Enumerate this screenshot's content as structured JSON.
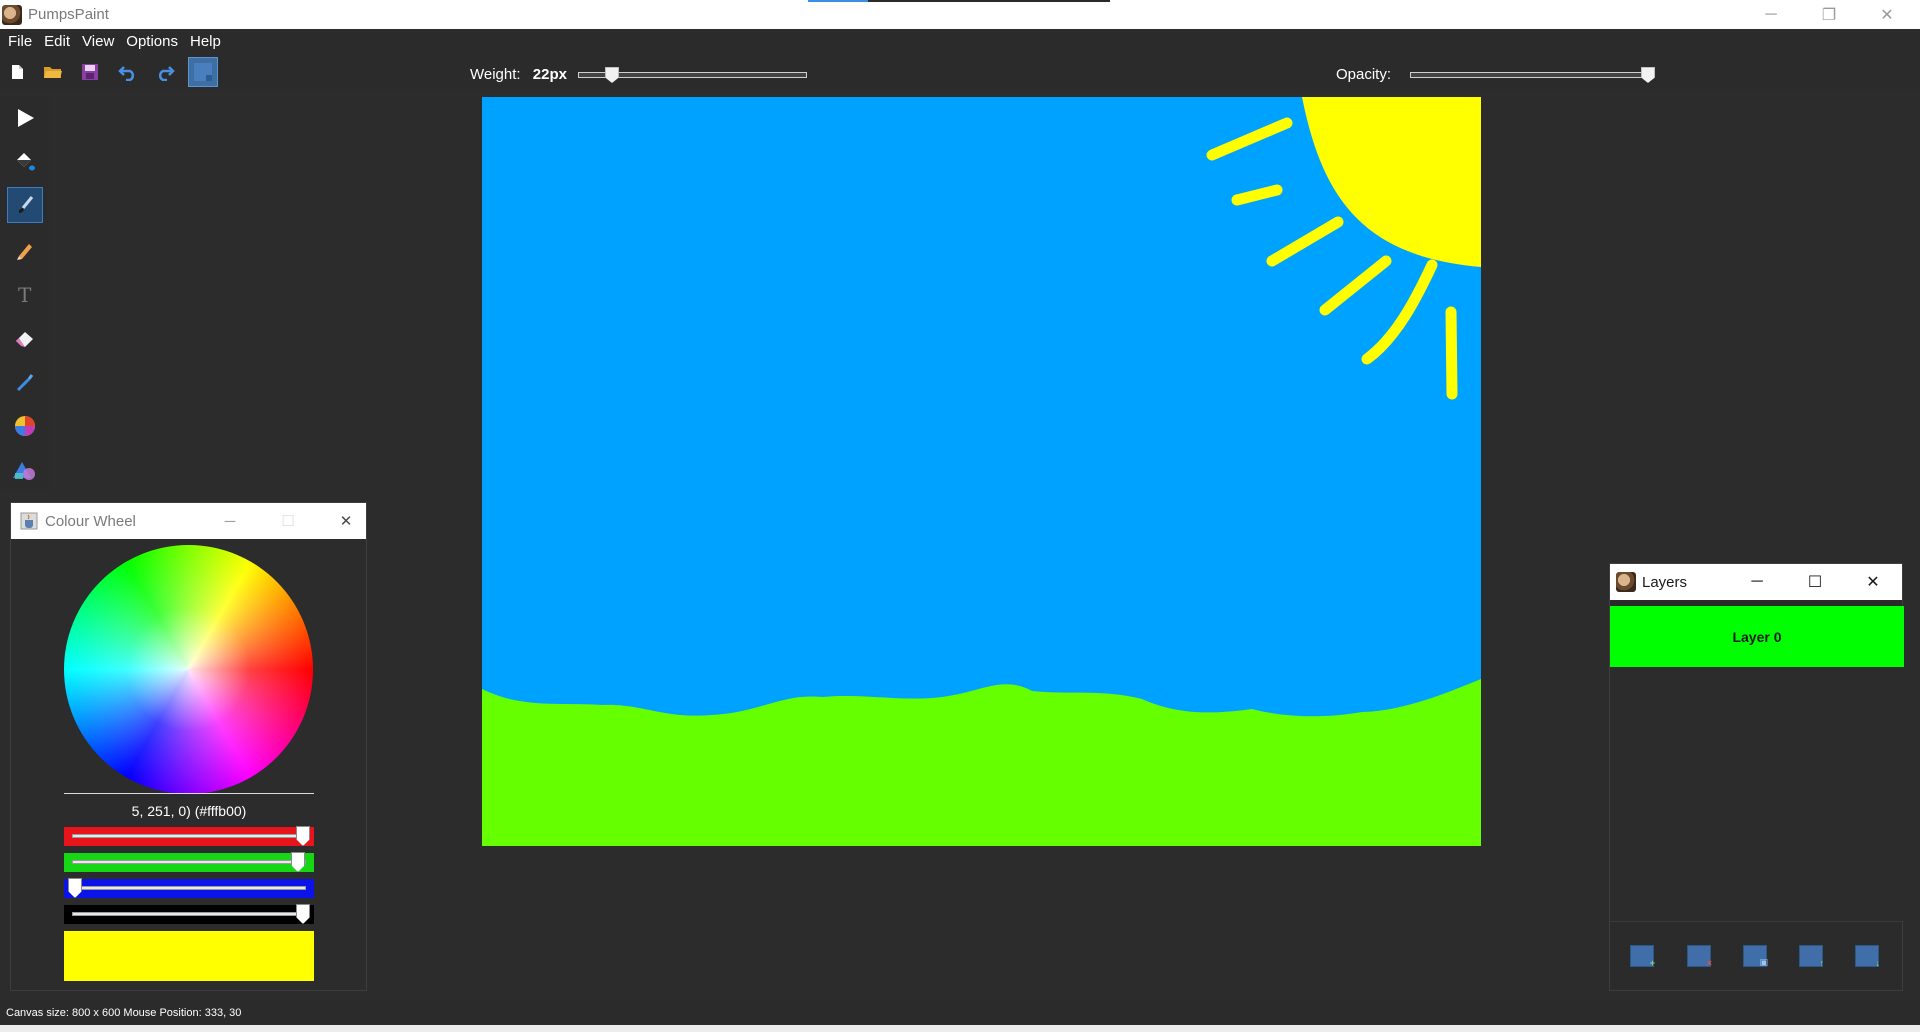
{
  "app": {
    "title": "PumpsPaint"
  },
  "window_controls": {
    "minimize": "─",
    "restore": "❐",
    "close": "✕"
  },
  "menu": {
    "items": [
      "File",
      "Edit",
      "View",
      "Options",
      "Help"
    ]
  },
  "toolbar": {
    "buttons": [
      "new-file",
      "open-folder",
      "save",
      "undo",
      "redo",
      "new-layer"
    ],
    "weight_label": "Weight:",
    "weight_value": "22px",
    "weight_level": 0.12,
    "opacity_label": "Opacity:",
    "opacity_level": 1.0
  },
  "tools": [
    "select-arrow",
    "fill-bucket",
    "brush",
    "pencil",
    "text",
    "eraser",
    "eyedropper",
    "colour-wheel",
    "shapes"
  ],
  "active_tool": "brush",
  "canvas": {
    "sky_color": "#00a2ff",
    "grass_color": "#66ff00",
    "sun_color": "#ffff00"
  },
  "colour_wheel": {
    "title": "Colour Wheel",
    "controls": {
      "minimize": "─",
      "maximize": "☐",
      "close": "✕"
    },
    "rgb_text": "5, 251, 0) (#fffb00)",
    "channels": [
      {
        "name": "red",
        "color": "#e8141c",
        "level": 1.0
      },
      {
        "name": "green",
        "color": "#16d616",
        "level": 0.98
      },
      {
        "name": "blue",
        "color": "#0a14e8",
        "level": 0.0
      },
      {
        "name": "alpha",
        "color": "#000000",
        "level": 1.0
      }
    ],
    "swatch_color": "#ffff00"
  },
  "layers": {
    "title": "Layers",
    "controls": {
      "minimize": "─",
      "maximize": "☐",
      "close": "✕"
    },
    "items": [
      {
        "name": "Layer 0",
        "color": "#00ff00"
      }
    ],
    "buttons": [
      "add-layer",
      "delete-layer",
      "duplicate-layer",
      "move-layer-up",
      "move-layer-down"
    ]
  },
  "status": {
    "text": "Canvas size: 800 x 600  Mouse Position: 333, 30"
  }
}
